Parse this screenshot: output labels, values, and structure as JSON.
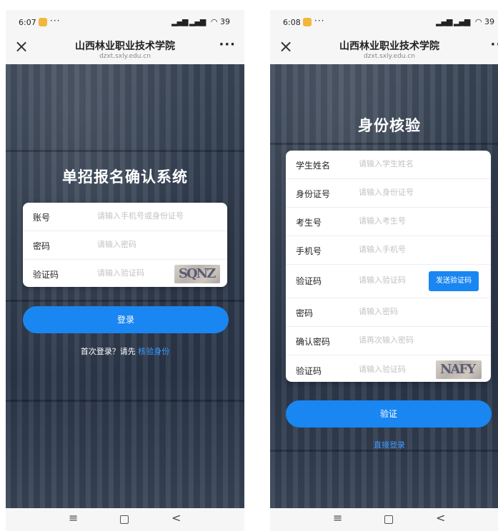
{
  "left": {
    "status": {
      "time": "6:07",
      "more": "···",
      "right": "39"
    },
    "nav": {
      "close": "×",
      "title": "山西林业职业技术学院",
      "url": "dzxt.sxly.edu.cn",
      "menu": "···"
    },
    "page_title": "单招报名确认系统",
    "form": [
      {
        "label": "账号",
        "placeholder": "请输入手机号或身份证号"
      },
      {
        "label": "密码",
        "placeholder": "请输入密码"
      },
      {
        "label": "验证码",
        "placeholder": "请输入验证码",
        "captcha": "SQNZ"
      }
    ],
    "login_button": "登录",
    "hint_prefix": "首次登录？请先 ",
    "hint_link": "核验身份"
  },
  "right": {
    "status": {
      "time": "6:08",
      "more": "···",
      "right": "39"
    },
    "nav": {
      "close": "×",
      "title": "山西林业职业技术学院",
      "url": "dzxt.sxly.edu.cn",
      "menu": "···"
    },
    "page_title": "身份核验",
    "form": [
      {
        "label": "学生姓名",
        "placeholder": "请输入学生姓名"
      },
      {
        "label": "身份证号",
        "placeholder": "请输入身份证号"
      },
      {
        "label": "考生号",
        "placeholder": "请输入考生号"
      },
      {
        "label": "手机号",
        "placeholder": "请输入手机号"
      },
      {
        "label": "验证码",
        "placeholder": "请输入验证码",
        "button": "发送验证码"
      },
      {
        "label": "密码",
        "placeholder": "请输入密码"
      },
      {
        "label": "确认密码",
        "placeholder": "请再次输入密码"
      },
      {
        "label": "验证码",
        "placeholder": "请输入验证码",
        "captcha": "NAFY"
      }
    ],
    "verify_button": "验证",
    "direct_login": "直接登录"
  },
  "bottom_nav": {
    "menu": "≡",
    "back": "<"
  },
  "colors": {
    "accent": "#1a86f1",
    "link": "#3b9bff",
    "background": "#2f3b4d"
  }
}
